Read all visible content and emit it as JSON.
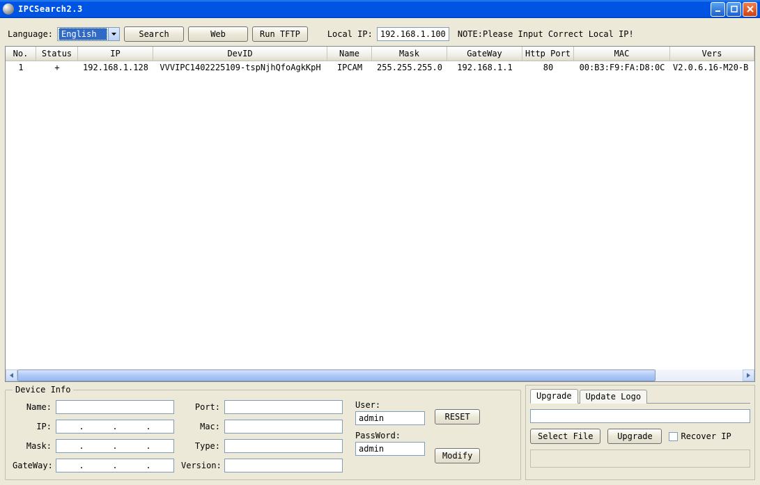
{
  "window": {
    "title": "IPCSearch2.3"
  },
  "toolbar": {
    "language_label": "Language:",
    "language_value": "English",
    "search_btn": "Search",
    "web_btn": "Web",
    "tftp_btn": "Run TFTP",
    "local_ip_label": "Local IP:",
    "local_ip_value": "192.168.1.100",
    "note": "NOTE:Please Input Correct Local IP!"
  },
  "grid": {
    "headers": {
      "no": "No.",
      "status": "Status",
      "ip": "IP",
      "devid": "DevID",
      "name": "Name",
      "mask": "Mask",
      "gateway": "GateWay",
      "port": "Http Port",
      "mac": "MAC",
      "vers": "Vers"
    },
    "rows": [
      {
        "no": "1",
        "status": "+",
        "ip": "192.168.1.128",
        "devid": "VVVIPC1402225109-tspNjhQfoAgkKpH",
        "name": "IPCAM",
        "mask": "255.255.255.0",
        "gateway": "192.168.1.1",
        "port": "80",
        "mac": "00:B3:F9:FA:D8:0C",
        "vers": "V2.0.6.16-M20-B"
      }
    ]
  },
  "device_info": {
    "legend": "Device Info",
    "name_label": "Name:",
    "name_value": "",
    "ip_label": "IP:",
    "ip_value": "",
    "mask_label": "Mask:",
    "mask_value": "",
    "gateway_label": "GateWay:",
    "gateway_value": "",
    "port_label": "Port:",
    "port_value": "",
    "mac_label": "Mac:",
    "mac_value": "",
    "type_label": "Type:",
    "type_value": "",
    "version_label": "Version:",
    "version_value": "",
    "user_label": "User:",
    "user_value": "admin",
    "password_label": "PassWord:",
    "password_value": "admin",
    "reset_btn": "RESET",
    "modify_btn": "Modify"
  },
  "upgrade": {
    "tab_upgrade": "Upgrade",
    "tab_logo": "Update Logo",
    "file_value": "",
    "select_file_btn": "Select File",
    "upgrade_btn": "Upgrade",
    "recover_ip_label": "Recover IP"
  }
}
